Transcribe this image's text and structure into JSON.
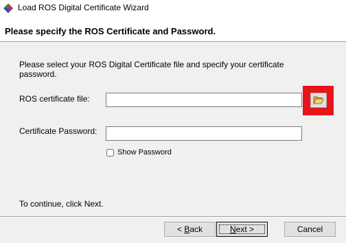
{
  "window": {
    "title": "Load ROS Digital Certificate Wizard",
    "icon": "app-diamond-icon"
  },
  "header": {
    "title": "Please specify the ROS Certificate and Password."
  },
  "form": {
    "instructions": "Please select your ROS Digital Certificate file and specify your certificate password.",
    "cert_label": "ROS certificate file:",
    "cert_value": "",
    "browse_icon": "open-folder-icon",
    "password_label": "Certificate Password:",
    "password_value": "",
    "show_password_label": "Show Password",
    "show_password_checked": false
  },
  "footer": {
    "hint": "To continue, click Next."
  },
  "buttons": {
    "back_mnemonic": "B",
    "back_rest": "ack",
    "back_prefix": "< ",
    "next_mnemonic": "N",
    "next_rest": "ext >",
    "cancel_label": "Cancel"
  },
  "colors": {
    "highlight": "#e8141c",
    "dialog_bg": "#f0f0f0"
  }
}
